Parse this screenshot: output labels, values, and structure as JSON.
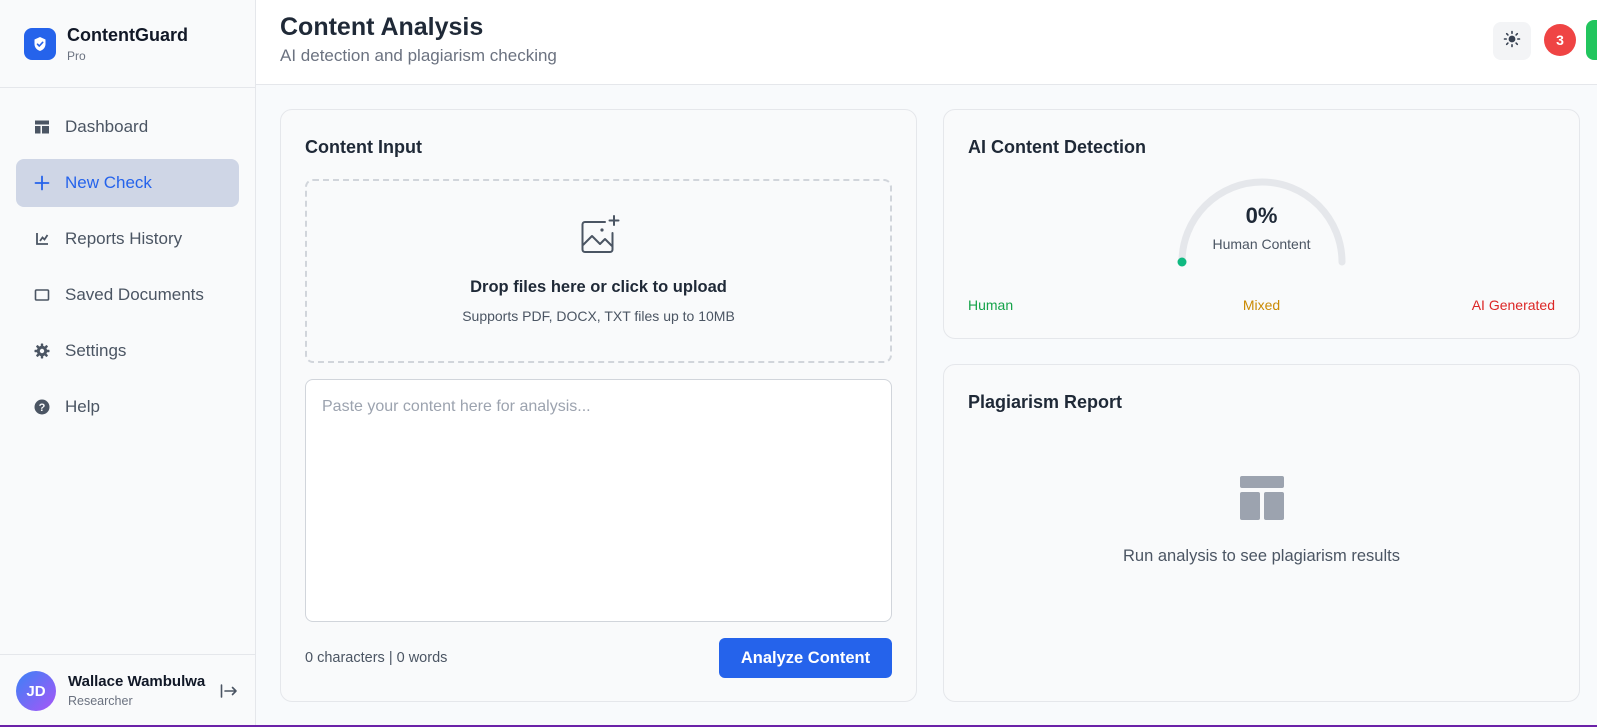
{
  "brand": {
    "name": "ContentGuard",
    "plan": "Pro"
  },
  "sidebar": {
    "items": [
      {
        "label": "Dashboard",
        "icon": "dashboard-icon",
        "active": false
      },
      {
        "label": "New Check",
        "icon": "plus-icon",
        "active": true
      },
      {
        "label": "Reports History",
        "icon": "history-icon",
        "active": false
      },
      {
        "label": "Saved Documents",
        "icon": "document-icon",
        "active": false
      },
      {
        "label": "Settings",
        "icon": "gear-icon",
        "active": false
      },
      {
        "label": "Help",
        "icon": "help-icon",
        "active": false
      }
    ]
  },
  "user": {
    "initials": "JD",
    "name": "Wallace Wambulwa",
    "role": "Researcher"
  },
  "header": {
    "title": "Content Analysis",
    "subtitle": "AI detection and plagiarism checking",
    "notification_count": "3"
  },
  "content_input": {
    "title": "Content Input",
    "drop_title": "Drop files here or click to upload",
    "drop_subtitle": "Supports PDF, DOCX, TXT files up to 10MB",
    "textarea_placeholder": "Paste your content here for analysis...",
    "textarea_value": "",
    "counter": "0 characters | 0 words",
    "analyze_label": "Analyze Content"
  },
  "ai_detection": {
    "title": "AI Content Detection",
    "value": "0%",
    "value_fraction": 0,
    "label": "Human Content",
    "legend": {
      "human": "Human",
      "mixed": "Mixed",
      "ai": "AI Generated"
    }
  },
  "plagiarism": {
    "title": "Plagiarism Report",
    "empty_text": "Run analysis to see plagiarism results"
  },
  "colors": {
    "accent": "#2563eb",
    "active_nav_bg": "#cfd6e6",
    "human": "#16a34a",
    "mixed": "#ca8a04",
    "ai": "#dc2626",
    "notification": "#ef4444",
    "gauge_marker": "#10b981"
  }
}
